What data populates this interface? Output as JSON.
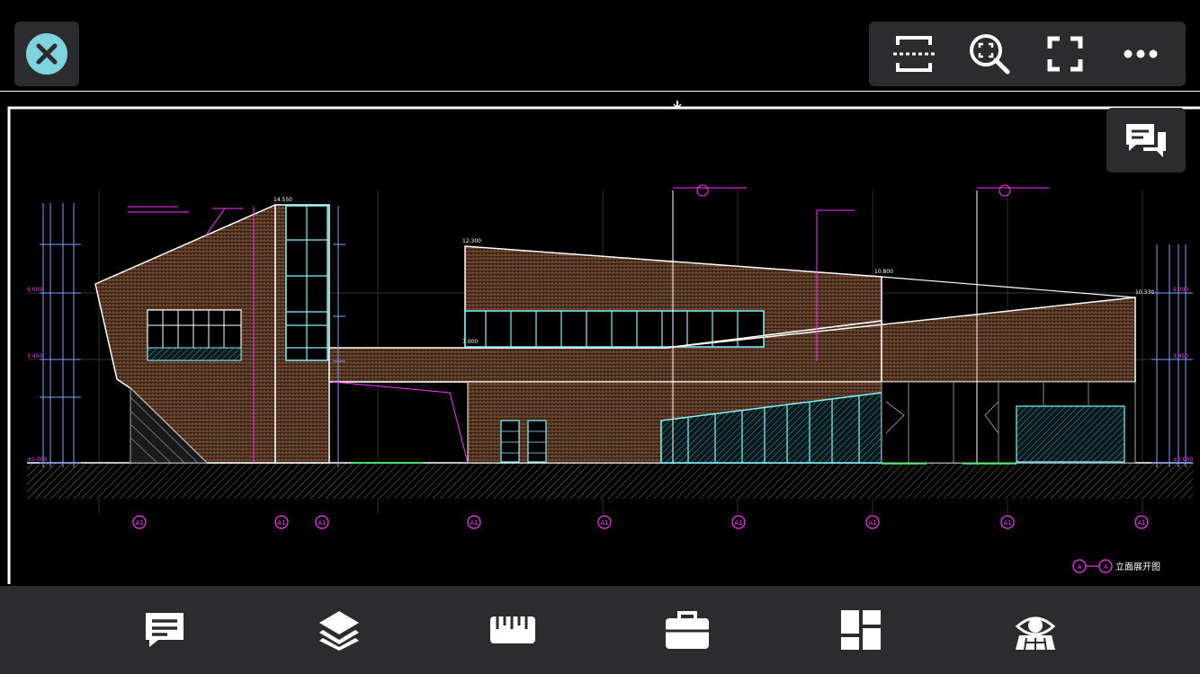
{
  "toolbar": {
    "close_icon": "close-icon",
    "tools": [
      "frame-select-icon",
      "zoom-window-icon",
      "fullscreen-icon",
      "more-icon"
    ]
  },
  "drawing": {
    "elevation_title": "立面展开图",
    "title_axis_start": "A",
    "title_axis_end": "A",
    "axis_labels": [
      "A1",
      "A1",
      "A1",
      "A1",
      "A1",
      "A1",
      "A1",
      "A1",
      "A1"
    ],
    "level_labels": [
      "9.000",
      "3.450",
      "±0.000",
      "9.000",
      "3.450",
      "±0.000"
    ],
    "height_labels": [
      "14.550",
      "12.300",
      "10.800",
      "10.330",
      "7.000"
    ],
    "line_colors": {
      "magenta": "#ff33ff",
      "cyan": "#7ff5ff",
      "brown": "#8b5a3c",
      "white": "#ffffff"
    }
  },
  "bottom_bar": {
    "items": [
      "comment-icon",
      "layers-icon",
      "ruler-icon",
      "toolbox-icon",
      "layout-icon",
      "view-3d-icon"
    ]
  }
}
